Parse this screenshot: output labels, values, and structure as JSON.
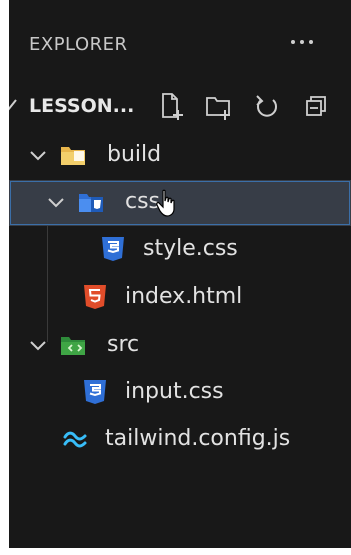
{
  "explorer": {
    "title": "EXPLORER",
    "more_icon": "ellipsis-icon"
  },
  "section": {
    "title": "LESSON...",
    "actions": [
      "new-file-icon",
      "new-folder-icon",
      "refresh-icon",
      "collapse-all-icon"
    ]
  },
  "tree": [
    {
      "label": "build",
      "type": "folder",
      "expanded": true,
      "icon": "folder-build-icon"
    },
    {
      "label": "css",
      "type": "folder",
      "expanded": true,
      "selected": true,
      "icon": "folder-css-icon"
    },
    {
      "label": "style.css",
      "type": "file",
      "icon": "css3-icon"
    },
    {
      "label": "index.html",
      "type": "file",
      "icon": "html5-icon"
    },
    {
      "label": "src",
      "type": "folder",
      "expanded": true,
      "icon": "folder-src-icon"
    },
    {
      "label": "input.css",
      "type": "file",
      "icon": "css3-icon"
    },
    {
      "label": "tailwind.config.js",
      "type": "file",
      "icon": "tailwind-icon"
    }
  ],
  "colors": {
    "background": "#181818",
    "selection": "#373d47",
    "selection_border": "#3b6fa8",
    "css": "#2f6fd6",
    "html": "#e14d2a",
    "tailwind": "#38bdf8",
    "folder_build": "#e8b64c",
    "folder_src": "#3fa545"
  }
}
